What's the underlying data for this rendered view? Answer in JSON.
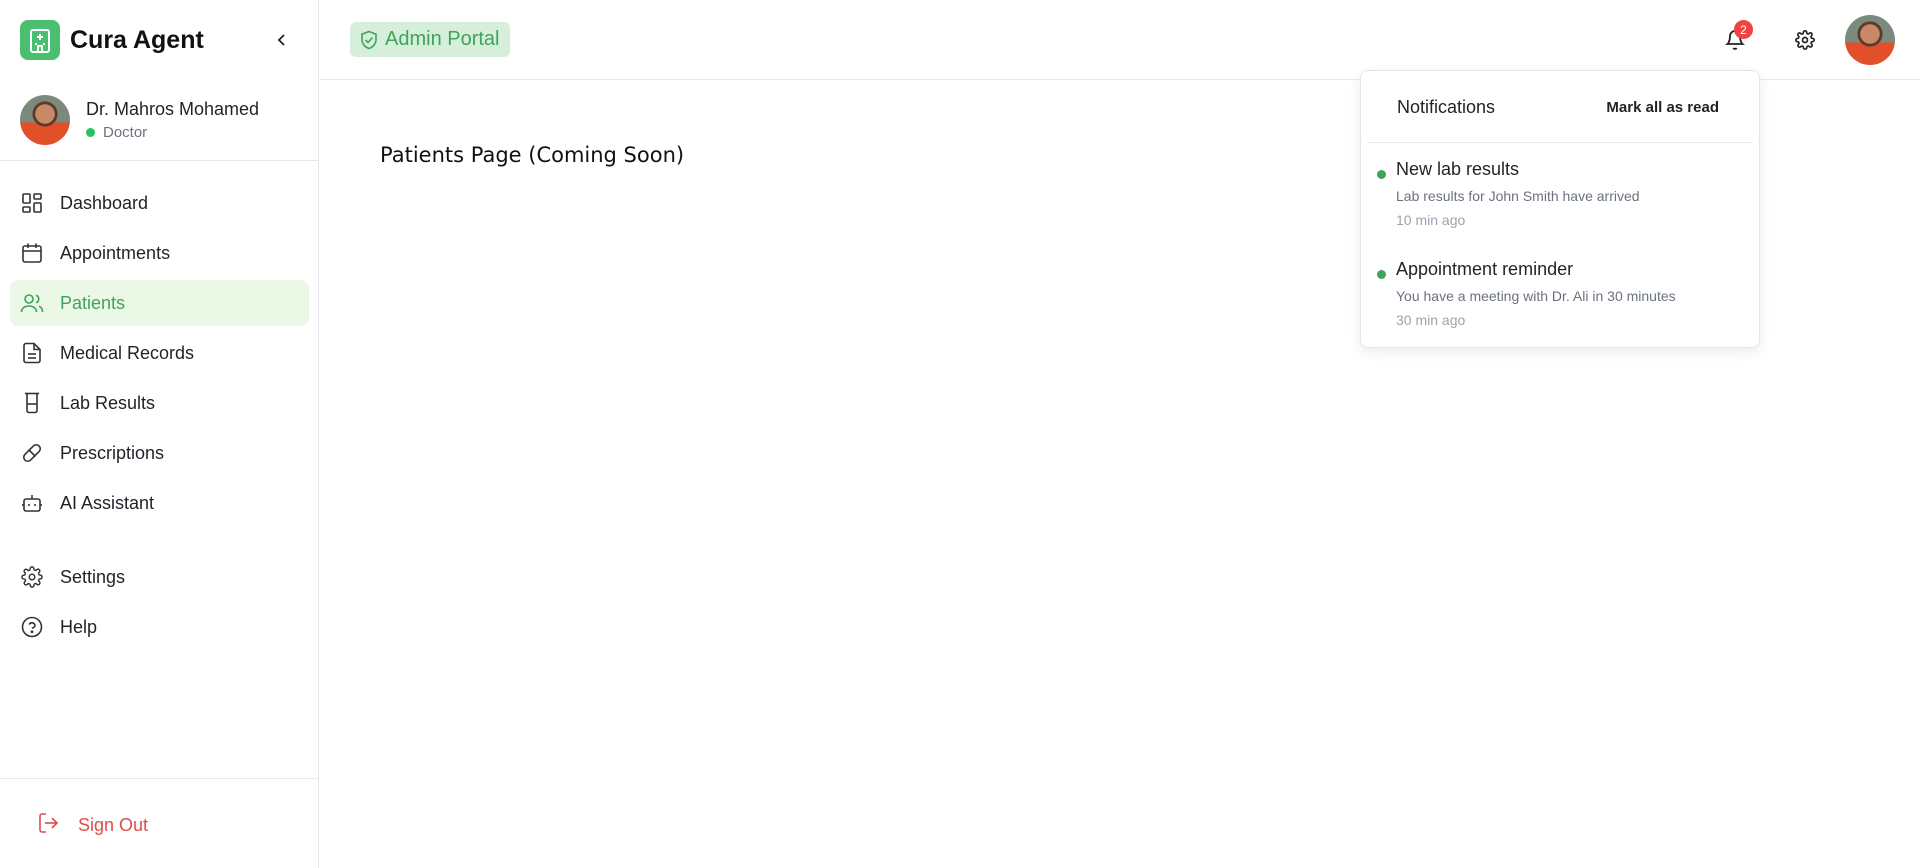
{
  "app": {
    "brand_name": "Cura Agent",
    "accent_color": "#4bbf70"
  },
  "user": {
    "name": "Dr. Mahros Mohamed",
    "role": "Doctor",
    "status_color": "#22c55e"
  },
  "sidebar": {
    "items": [
      {
        "label": "Dashboard",
        "icon": "dashboard-icon",
        "active": false
      },
      {
        "label": "Appointments",
        "icon": "calendar-icon",
        "active": false
      },
      {
        "label": "Patients",
        "icon": "users-icon",
        "active": true
      },
      {
        "label": "Medical Records",
        "icon": "file-text-icon",
        "active": false
      },
      {
        "label": "Lab Results",
        "icon": "beaker-icon",
        "active": false
      },
      {
        "label": "Prescriptions",
        "icon": "pill-icon",
        "active": false
      },
      {
        "label": "AI Assistant",
        "icon": "bot-icon",
        "active": false
      }
    ],
    "secondary": [
      {
        "label": "Settings",
        "icon": "gear-icon"
      },
      {
        "label": "Help",
        "icon": "help-circle-icon"
      }
    ],
    "sign_out_label": "Sign Out"
  },
  "header": {
    "portal_label": "Admin Portal",
    "notification_count": "2"
  },
  "main": {
    "page_title": "Patients Page (Coming Soon)"
  },
  "notifications": {
    "title": "Notifications",
    "mark_all_label": "Mark all as read",
    "items": [
      {
        "title": "New lab results",
        "description": "Lab results for John Smith have arrived",
        "time": "10 min ago"
      },
      {
        "title": "Appointment reminder",
        "description": "You have a meeting with Dr. Ali in 30 minutes",
        "time": "30 min ago"
      }
    ]
  }
}
